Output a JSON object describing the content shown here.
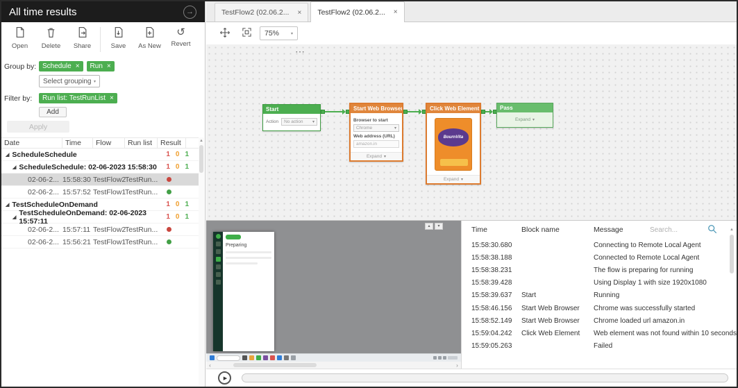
{
  "icons": {
    "forward": "→",
    "close": "×",
    "caret_down": "▾",
    "tree_expanded": "◢",
    "more": "⋯",
    "revert": "↺",
    "play": "▶",
    "scroll_up": "▲",
    "scroll_left": "‹",
    "scroll_right": "›",
    "chevron_up": "▴",
    "chevron_down": "▾"
  },
  "colors": {
    "accent_green": "#4cae50",
    "accent_orange": "#e0863c",
    "fail_red": "#d9534f",
    "warn_orange": "#f0a030",
    "pass_green": "#4cae50",
    "header_dark": "#1c1c1c"
  },
  "left_panel": {
    "title": "All time results",
    "toolbar": {
      "open": "Open",
      "delete": "Delete",
      "share": "Share",
      "save": "Save",
      "as_new": "As New",
      "revert": "Revert"
    },
    "group_by": {
      "label": "Group by:",
      "tag1": "Schedule",
      "tag2": "Run",
      "grouping_placeholder": "Select grouping"
    },
    "filter_by": {
      "label": "Filter by:",
      "tag1": "Run list: TestRunList",
      "add": "Add"
    },
    "apply": "Apply",
    "table": {
      "col_date": "Date",
      "col_time": "Time",
      "col_flow": "Flow",
      "col_runlist": "Run list",
      "col_result": "Result",
      "rows": [
        {
          "label": "ScheduleSchedule",
          "failed": "1",
          "warn": "0",
          "passed": "1"
        },
        {
          "label": "ScheduleSchedule: 02-06-2023 15:58:30",
          "failed": "1",
          "warn": "0",
          "passed": "1"
        },
        {
          "date": "02-06-2...",
          "time": "15:58:30",
          "flow": "TestFlow2",
          "runlist": "TestRun...",
          "result": "failed"
        },
        {
          "date": "02-06-2...",
          "time": "15:57:52",
          "flow": "TestFlow1",
          "runlist": "TestRun...",
          "result": "passed"
        },
        {
          "label": "TestScheduleOnDemand",
          "failed": "1",
          "warn": "0",
          "passed": "1"
        },
        {
          "label": "TestScheduleOnDemand: 02-06-2023 15:57:11",
          "failed": "1",
          "warn": "0",
          "passed": "1"
        },
        {
          "date": "02-06-2...",
          "time": "15:57:11",
          "flow": "TestFlow2",
          "runlist": "TestRun...",
          "result": "failed"
        },
        {
          "date": "02-06-2...",
          "time": "15:56:21",
          "flow": "TestFlow1",
          "runlist": "TestRun...",
          "result": "passed"
        }
      ]
    }
  },
  "tabs": {
    "tab1": "TestFlow2 (02.06.2...",
    "tab2": "TestFlow2 (02.06.2..."
  },
  "canvas": {
    "zoom": "75%",
    "blocks": {
      "start": {
        "title": "Start",
        "action_label": "Action",
        "action_value": "No action"
      },
      "browser": {
        "title": "Start Web Browser",
        "browser_label": "Browser to start",
        "browser_value": "Chrome",
        "url_label": "Web address (URL)",
        "url_value": "amazon.in",
        "expand": "Expand"
      },
      "click": {
        "title": "Click Web Element",
        "image_label": "BournVita",
        "expand": "Expand"
      },
      "pass": {
        "title": "Pass",
        "expand": "Expand"
      }
    }
  },
  "preview": {
    "window_text": "Preparing"
  },
  "log": {
    "col_time": "Time",
    "col_block": "Block name",
    "col_message": "Message",
    "search_placeholder": "Search...",
    "rows": [
      {
        "time": "15:58:30.680",
        "block": "",
        "message": "Connecting to Remote Local Agent"
      },
      {
        "time": "15:58:38.188",
        "block": "",
        "message": "Connected to Remote Local Agent"
      },
      {
        "time": "15:58:38.231",
        "block": "",
        "message": "The flow is preparing for running"
      },
      {
        "time": "15:58:39.428",
        "block": "",
        "message": "Using Display 1 with size 1920x1080"
      },
      {
        "time": "15:58:39.637",
        "block": "Start",
        "message": "Running"
      },
      {
        "time": "15:58:46.156",
        "block": "Start Web Browser",
        "message": "Chrome was successfully started"
      },
      {
        "time": "15:58:52.149",
        "block": "Start Web Browser",
        "message": "Chrome loaded url amazon.in"
      },
      {
        "time": "15:59:04.242",
        "block": "Click Web Element",
        "message": "Web element was not found within 10 seconds"
      },
      {
        "time": "15:59:05.263",
        "block": "",
        "message": "Failed"
      }
    ]
  }
}
